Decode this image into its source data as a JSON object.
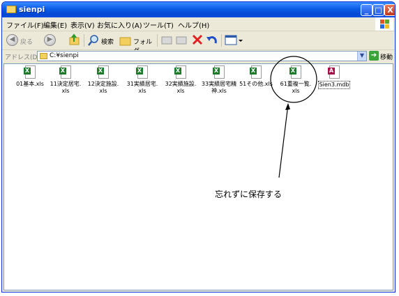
{
  "window": {
    "title": "sienpi"
  },
  "caption_buttons": {
    "minimize": "_",
    "maximize": "□",
    "close": "X"
  },
  "menu": [
    "ファイル(F)",
    "編集(E)",
    "表示(V)",
    "お気に入り(A)",
    "ツール(T)",
    "ヘルプ(H)"
  ],
  "toolbar": {
    "back_label": "戻る",
    "search_label": "検索",
    "folders_label": "フォルダ"
  },
  "address": {
    "label": "アドレス(D)",
    "value": "C:¥sienpi",
    "go_label": "移動"
  },
  "files": [
    {
      "name": "01基本.xls",
      "type": "excel"
    },
    {
      "name": "11決定居宅.\nxls",
      "type": "excel"
    },
    {
      "name": "12決定施設.\nxls",
      "type": "excel"
    },
    {
      "name": "31実績居宅.\nxls",
      "type": "excel"
    },
    {
      "name": "32実績施設.\nxls",
      "type": "excel"
    },
    {
      "name": "33実績居宅精\n神.xls",
      "type": "excel"
    },
    {
      "name": "51その他.xls",
      "type": "excel"
    },
    {
      "name": "61重複一覧.\nxls",
      "type": "excel"
    },
    {
      "name": "Sien3.mdb",
      "type": "access"
    }
  ],
  "annotation": {
    "text": "忘れずに保存する"
  }
}
